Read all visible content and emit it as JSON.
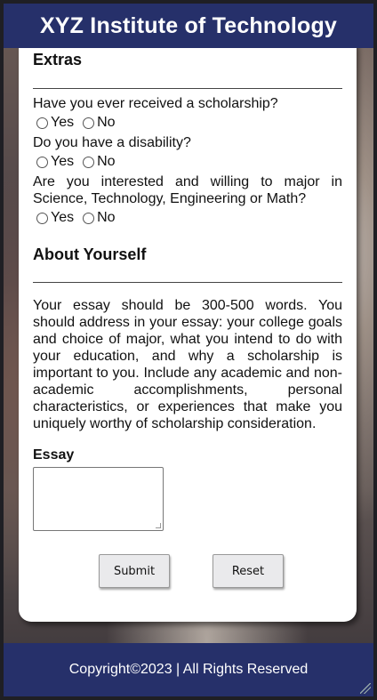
{
  "header": {
    "title": "XYZ Institute of Technology"
  },
  "extras": {
    "title": "Extras",
    "questions": [
      {
        "text": "Have you ever received a scholarship?",
        "options": [
          "Yes",
          "No"
        ]
      },
      {
        "text": "Do you have a disability?",
        "options": [
          "Yes",
          "No"
        ]
      },
      {
        "text": "Are you interested and willing to major in Science, Technology, Engineering or Math?",
        "options": [
          "Yes",
          "No"
        ]
      }
    ]
  },
  "about": {
    "title": "About Yourself",
    "instructions": "Your essay should be 300-500 words. You should address in your essay: your college goals and choice of major, what you intend to do with your education, and why a scholarship is important to you. Include any academic and non-academic accomplishments, personal characteristics, or experiences that make you uniquely worthy of scholarship consideration.",
    "essay_label": "Essay",
    "essay_value": ""
  },
  "buttons": {
    "submit": "Submit",
    "reset": "Reset"
  },
  "footer": {
    "text": "Copyright©2023 | All Rights Reserved"
  },
  "colors": {
    "header_bg": "#26306a",
    "card_bg": "#ffffff"
  }
}
